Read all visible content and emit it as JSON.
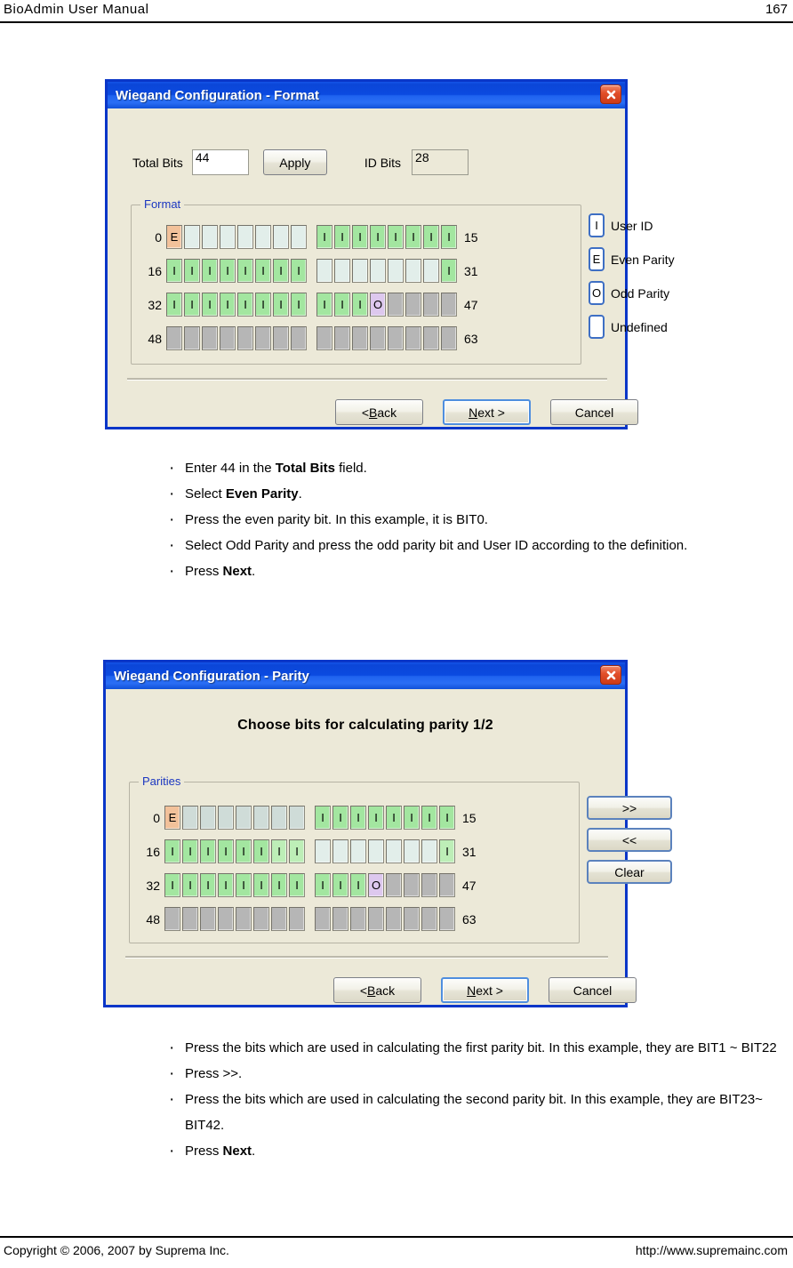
{
  "running_head": {
    "title": "BioAdmin  User  Manual",
    "page_number": "167"
  },
  "footer": {
    "copyright": "Copyright © 2006, 2007 by Suprema Inc.",
    "url": "http://www.supremainc.com"
  },
  "dialog_format": {
    "title": "Wiegand Configuration - Format",
    "close_icon": "close-icon",
    "total_bits_label": "Total Bits",
    "total_bits_value": "44",
    "apply_label": "Apply",
    "id_bits_label": "ID Bits",
    "id_bits_value": "28",
    "group_legend": "Format",
    "rows": [
      {
        "start": "0",
        "end": "15",
        "cells": [
          "E",
          "",
          "",
          "",
          "",
          "",
          "",
          "",
          "I",
          "I",
          "I",
          "I",
          "I",
          "I",
          "I",
          "I"
        ],
        "states": [
          "even",
          "undef",
          "undef",
          "undef",
          "undef",
          "undef",
          "undef",
          "undef",
          "id",
          "id",
          "id",
          "id",
          "id",
          "id",
          "id",
          "id"
        ]
      },
      {
        "start": "16",
        "end": "31",
        "cells": [
          "I",
          "I",
          "I",
          "I",
          "I",
          "I",
          "I",
          "I",
          "",
          "",
          "",
          "",
          "",
          "",
          "",
          "I"
        ],
        "states": [
          "id",
          "id",
          "id",
          "id",
          "id",
          "id",
          "id",
          "id",
          "undef",
          "undef",
          "undef",
          "undef",
          "undef",
          "undef",
          "undef",
          "id"
        ]
      },
      {
        "start": "32",
        "end": "47",
        "cells": [
          "I",
          "I",
          "I",
          "I",
          "I",
          "I",
          "I",
          "I",
          "I",
          "I",
          "I",
          "O",
          "",
          "",
          "",
          ""
        ],
        "states": [
          "id",
          "id",
          "id",
          "id",
          "id",
          "id",
          "id",
          "id",
          "id",
          "id",
          "id",
          "odd",
          "gray",
          "gray",
          "gray",
          "gray"
        ]
      },
      {
        "start": "48",
        "end": "63",
        "cells": [
          "",
          "",
          "",
          "",
          "",
          "",
          "",
          "",
          "",
          "",
          "",
          "",
          "",
          "",
          "",
          ""
        ],
        "states": [
          "gray",
          "gray",
          "gray",
          "gray",
          "gray",
          "gray",
          "gray",
          "gray",
          "gray",
          "gray",
          "gray",
          "gray",
          "gray",
          "gray",
          "gray",
          "gray"
        ]
      }
    ],
    "legend": [
      {
        "glyph": "I",
        "label": "User ID"
      },
      {
        "glyph": "E",
        "label": "Even Parity"
      },
      {
        "glyph": "O",
        "label": "Odd Parity"
      },
      {
        "glyph": "",
        "label": "Undefined"
      }
    ],
    "buttons": {
      "back": "< Back",
      "back_pre": "< ",
      "back_accel": "B",
      "back_post": "ack",
      "next_pre": "",
      "next_accel": "N",
      "next_post": "ext >",
      "cancel": "Cancel"
    }
  },
  "bullets_first": [
    {
      "parts": [
        {
          "t": "Enter 44 in the ",
          "b": false
        },
        {
          "t": "Total Bits",
          "b": true
        },
        {
          "t": " field.",
          "b": false
        }
      ]
    },
    {
      "parts": [
        {
          "t": "Select ",
          "b": false
        },
        {
          "t": "Even Parity",
          "b": true
        },
        {
          "t": ".",
          "b": false
        }
      ]
    },
    {
      "parts": [
        {
          "t": "Press the even parity bit. In this example, it is BIT0.",
          "b": false
        }
      ]
    },
    {
      "parts": [
        {
          "t": "Select Odd Parity and press the odd parity bit and User ID according to the definition.",
          "b": false
        }
      ]
    },
    {
      "parts": [
        {
          "t": "Press ",
          "b": false
        },
        {
          "t": "Next",
          "b": true
        },
        {
          "t": ".",
          "b": false
        }
      ]
    }
  ],
  "dialog_parity": {
    "title": "Wiegand Configuration - Parity",
    "close_icon": "close-icon",
    "heading": "Choose bits for calculating parity 1/2",
    "group_legend": "Parities",
    "rows": [
      {
        "start": "0",
        "end": "15",
        "cells": [
          "E",
          "",
          "",
          "",
          "",
          "",
          "",
          "",
          "I",
          "I",
          "I",
          "I",
          "I",
          "I",
          "I",
          "I"
        ],
        "states": [
          "even",
          "undef-sel",
          "undef-sel",
          "undef-sel",
          "undef-sel",
          "undef-sel",
          "undef-sel",
          "undef-sel",
          "id",
          "id",
          "id",
          "id",
          "id",
          "id",
          "id",
          "id"
        ]
      },
      {
        "start": "16",
        "end": "31",
        "cells": [
          "I",
          "I",
          "I",
          "I",
          "I",
          "I",
          "I",
          "I",
          "",
          "",
          "",
          "",
          "",
          "",
          "",
          "I"
        ],
        "states": [
          "id",
          "id",
          "id",
          "id",
          "id",
          "id",
          "id-lite",
          "id-lite",
          "undef",
          "undef",
          "undef",
          "undef",
          "undef",
          "undef",
          "undef",
          "id-lite"
        ]
      },
      {
        "start": "32",
        "end": "47",
        "cells": [
          "I",
          "I",
          "I",
          "I",
          "I",
          "I",
          "I",
          "I",
          "I",
          "I",
          "I",
          "O",
          "",
          "",
          "",
          ""
        ],
        "states": [
          "id",
          "id",
          "id",
          "id",
          "id",
          "id",
          "id",
          "id",
          "id",
          "id",
          "id",
          "odd",
          "gray",
          "gray",
          "gray",
          "gray"
        ]
      },
      {
        "start": "48",
        "end": "63",
        "cells": [
          "",
          "",
          "",
          "",
          "",
          "",
          "",
          "",
          "",
          "",
          "",
          "",
          "",
          "",
          "",
          ""
        ],
        "states": [
          "gray",
          "gray",
          "gray",
          "gray",
          "gray",
          "gray",
          "gray",
          "gray",
          "gray",
          "gray",
          "gray",
          "gray",
          "gray",
          "gray",
          "gray",
          "gray"
        ]
      }
    ],
    "side_buttons": [
      {
        "label": ">>"
      },
      {
        "label": "<<"
      },
      {
        "label": "Clear"
      }
    ],
    "buttons": {
      "back_pre": "< ",
      "back_accel": "B",
      "back_post": "ack",
      "next_accel": "N",
      "next_post": "ext >",
      "cancel": "Cancel"
    }
  },
  "bullets_second": [
    {
      "parts": [
        {
          "t": "Press the bits which are used in calculating the first parity bit. In this example, they are BIT1 ~ BIT22",
          "b": false
        }
      ]
    },
    {
      "parts": [
        {
          "t": "Press >>.",
          "b": false
        }
      ]
    },
    {
      "parts": [
        {
          "t": "Press the bits which are used in calculating the second parity bit. In this example, they are BIT23~ BIT42.",
          "b": false
        }
      ]
    },
    {
      "parts": [
        {
          "t": "Press ",
          "b": false
        },
        {
          "t": "Next",
          "b": true
        },
        {
          "t": ".",
          "b": false
        }
      ]
    }
  ],
  "colors": {
    "titlebar_blue": "#0b4ae0",
    "dialog_border": "#0a36c8",
    "dialog_face": "#ece9d8",
    "even_parity": "#f2c19a",
    "odd_parity": "#ddc8ee",
    "user_id": "#a3e6a0",
    "undefined_cell": "#b6b6b6",
    "legend_text": "#1a36c0"
  }
}
